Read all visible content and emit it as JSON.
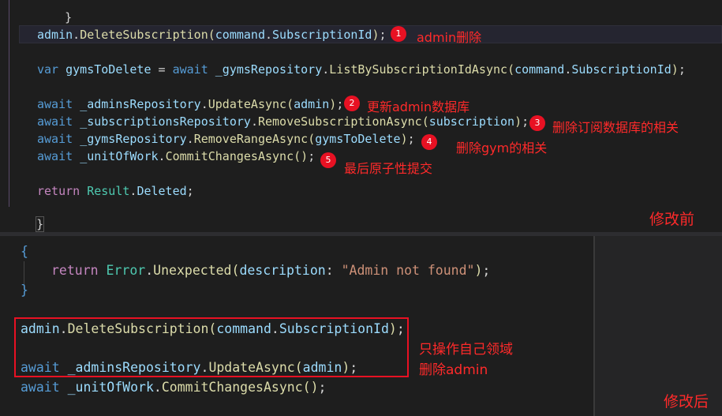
{
  "top": {
    "brace_top": "}",
    "l1_obj": "admin",
    "l1_fn": "DeleteSubscription",
    "l1_arg1": "command",
    "l1_arg2": "SubscriptionId",
    "l2_var": "var",
    "l2_name": "gymsToDelete",
    "l2_await": "await",
    "l2_repo": "_gymsRepository",
    "l2_fn": "ListBySubscriptionIdAsync",
    "l2_arg1": "command",
    "l2_arg2": "SubscriptionId",
    "l3_await": "await",
    "l3_repo": "_adminsRepository",
    "l3_fn": "UpdateAsync",
    "l3_arg": "admin",
    "l4_await": "await",
    "l4_repo": "_subscriptionsRepository",
    "l4_fn": "RemoveSubscriptionAsync",
    "l4_arg": "subscription",
    "l5_await": "await",
    "l5_repo": "_gymsRepository",
    "l5_fn": "RemoveRangeAsync",
    "l5_arg": "gymsToDelete",
    "l6_await": "await",
    "l6_repo": "_unitOfWork",
    "l6_fn": "CommitChangesAsync",
    "l7_ret": "return",
    "l7_type": "Result",
    "l7_member": "Deleted",
    "brace_bottom": "}",
    "annotations": {
      "b1": "1",
      "a1": "admin删除",
      "b2": "2",
      "a2": "更新admin数据库",
      "b3": "3",
      "a3": "删除订阅数据库的相关",
      "b4": "4",
      "a4": "删除gym的相关",
      "b5": "5",
      "a5": "最后原子性提交",
      "before": "修改前"
    }
  },
  "bottom": {
    "brace_open": "{",
    "ret": "return",
    "err_type": "Error",
    "err_fn": "Unexpected",
    "desc_param": "description",
    "desc_str": "\"Admin not found\"",
    "brace_close": "}",
    "l1_obj": "admin",
    "l1_fn": "DeleteSubscription",
    "l1_arg1": "command",
    "l1_arg2": "SubscriptionId",
    "l2_await": "await",
    "l2_repo": "_adminsRepository",
    "l2_fn": "UpdateAsync",
    "l2_arg": "admin",
    "l3_await": "await",
    "l3_repo": "_unitOfWork",
    "l3_fn": "CommitChangesAsync",
    "annotations": {
      "note1": "只操作自己领域",
      "note2": "删除admin",
      "after": "修改后"
    }
  }
}
